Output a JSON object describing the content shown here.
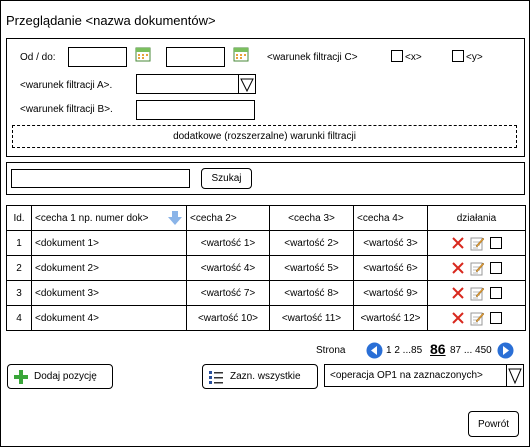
{
  "page": {
    "title": "Przeglądanie <nazwa dokumentów>"
  },
  "filters": {
    "date_label": "Od / do:",
    "condition_c_label": "<warunek filtracji C>",
    "checkbox_x_label": "<x>",
    "checkbox_y_label": "<y>",
    "condition_a_label": "<warunek filtracji A>.",
    "condition_b_label": "<warunek filtracji B>.",
    "advanced_label": "dodatkowe (rozszerzalne) warunki filtracji"
  },
  "search": {
    "button_label": "Szukaj",
    "value": ""
  },
  "table": {
    "headers": [
      "Id.",
      "<cecha 1 np. numer dok>",
      "<cecha 2>",
      "<cecha 3>",
      "<cecha 4>",
      "działania"
    ],
    "rows": [
      [
        "1",
        "<dokument 1>",
        "<wartość 1>",
        "<wartość 2>",
        "<wartość 3>"
      ],
      [
        "2",
        "<dokument 2>",
        "<wartość 4>",
        "<wartość 5>",
        "<wartość 6>"
      ],
      [
        "3",
        "<dokument 3>",
        "<wartość 7>",
        "<wartość 8>",
        "<wartość 9>"
      ],
      [
        "4",
        "<dokument 4>",
        "<wartość 10>",
        "<wartość 11>",
        "<wartość 12>"
      ]
    ]
  },
  "pagination": {
    "label": "Strona",
    "pages_before": "1 2 ...85",
    "current": "86",
    "pages_after": "87 ... 450"
  },
  "toolbar": {
    "add_label": "Dodaj pozycję",
    "select_all_label": "Zazn. wszystkie",
    "operation_label": "<operacja OP1 na zaznaczonych>"
  },
  "footer": {
    "back_label": "Powrót"
  },
  "colors": {
    "delete": "#d8281e",
    "nav": "#2a6fd6",
    "add": "#3aa63a"
  }
}
